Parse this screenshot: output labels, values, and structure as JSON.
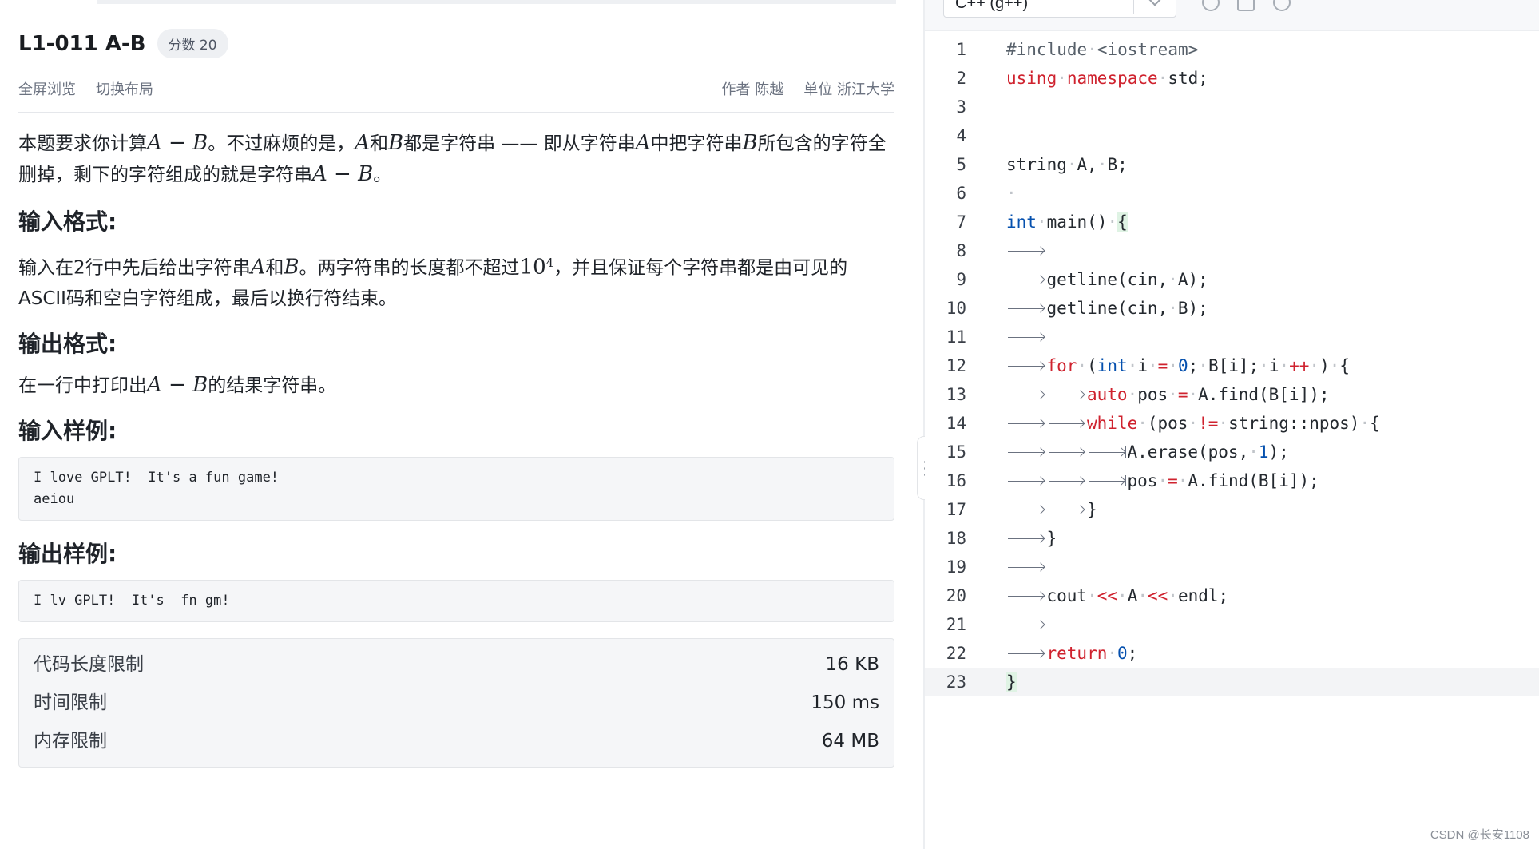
{
  "problem": {
    "title": "L1-011 A-B",
    "score_badge": "分数 20",
    "fullscreen_link": "全屏浏览",
    "switch_layout_link": "切换布局",
    "author": "作者 陈越",
    "organization": "单位 浙江大学",
    "description": {
      "t1": "本题要求你计算",
      "m1": "A − B",
      "t2": "。不过麻烦的是，",
      "m2": "A",
      "t3": "和",
      "m3": "B",
      "t4": "都是字符串 —— 即从字符串",
      "m4": "A",
      "t5": "中把字符串",
      "m5": "B",
      "t6": "所包含的字符全删掉，剩下的字符组成的就是字符串",
      "m6": "A − B",
      "t7": "。"
    },
    "input_heading": "输入格式:",
    "input_text": {
      "t1": "输入在2行中先后给出字符串",
      "m1": "A",
      "t2": "和",
      "m2": "B",
      "t3": "。两字符串的长度都不超过",
      "m3": "10",
      "m3sup": "4",
      "t4": "，并且保证每个字符串都是由可见的ASCII码和空白字符组成，最后以换行符结束。"
    },
    "output_heading": "输出格式:",
    "output_text": {
      "t1": "在一行中打印出",
      "m1": "A − B",
      "t2": "的结果字符串。"
    },
    "sample_input_heading": "输入样例:",
    "sample_input": "I love GPLT!  It's a fun game!\naeiou",
    "sample_output_heading": "输出样例:",
    "sample_output": "I lv GPLT!  It's  fn gm!",
    "limits": [
      {
        "label": "代码长度限制",
        "value": "16 KB"
      },
      {
        "label": "时间限制",
        "value": "150 ms"
      },
      {
        "label": "内存限制",
        "value": "64 MB"
      }
    ]
  },
  "editor": {
    "language": "C++ (g++)",
    "line_numbers": [
      "1",
      "2",
      "3",
      "4",
      "5",
      "6",
      "7",
      "8",
      "9",
      "10",
      "11",
      "12",
      "13",
      "14",
      "15",
      "16",
      "17",
      "18",
      "19",
      "20",
      "21",
      "22",
      "23"
    ],
    "code_lines": [
      "#include <iostream>",
      "using namespace std;",
      "",
      "",
      "string A, B;",
      "",
      "int main() {",
      "",
      "getline(cin, A);",
      "getline(cin, B);",
      "",
      "for (int i = 0; B[i]; i ++ ) {",
      "auto pos = A.find(B[i]);",
      "while (pos != string::npos) {",
      "A.erase(pos, 1);",
      "pos = A.find(B[i]);",
      "}",
      "}",
      "",
      "cout << A << endl;",
      "",
      "return 0;",
      "}"
    ]
  },
  "watermark": "CSDN @长安1108"
}
